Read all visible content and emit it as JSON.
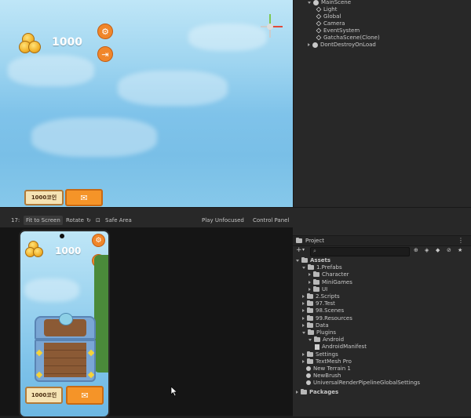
{
  "scene": {
    "score": "1000",
    "coin_button_label": "1000코인",
    "settings_icon": "gear-icon",
    "exit_icon": "exit-icon",
    "shop_icon": "shop-icon"
  },
  "hierarchy": {
    "rows": [
      {
        "label": "MainScene",
        "indent": 0,
        "type": "scene",
        "expanded": true
      },
      {
        "label": "Light",
        "indent": 1,
        "type": "gameobject"
      },
      {
        "label": "Global",
        "indent": 1,
        "type": "gameobject"
      },
      {
        "label": "Camera",
        "indent": 1,
        "type": "gameobject"
      },
      {
        "label": "EventSystem",
        "indent": 1,
        "type": "gameobject"
      },
      {
        "label": "GatchaScene(Clone)",
        "indent": 1,
        "type": "gameobject"
      },
      {
        "label": "DontDestroyOnLoad",
        "indent": 0,
        "type": "scene",
        "expanded": false
      }
    ]
  },
  "game_toolbar": {
    "display": "17:",
    "fit_to_screen": "Fit to Screen",
    "rotate": "Rotate",
    "safe_area": "Safe Area",
    "play_unfocused": "Play Unfocused",
    "control_panel": "Control Panel"
  },
  "game_view": {
    "score": "1000",
    "coin_button_label": "1000코인"
  },
  "project": {
    "tab_label": "Project",
    "search_placeholder": "",
    "rows": [
      {
        "label": "Assets",
        "indent": 0,
        "icon": "folder",
        "expanded": true,
        "bold": true
      },
      {
        "label": "1.Prefabs",
        "indent": 1,
        "icon": "folder",
        "expanded": true
      },
      {
        "label": "Character",
        "indent": 2,
        "icon": "folder",
        "expanded": false
      },
      {
        "label": "MiniGames",
        "indent": 2,
        "icon": "folder",
        "expanded": false
      },
      {
        "label": "UI",
        "indent": 2,
        "icon": "folder",
        "expanded": false
      },
      {
        "label": "2.Scripts",
        "indent": 1,
        "icon": "folder",
        "expanded": false
      },
      {
        "label": "97.Test",
        "indent": 1,
        "icon": "folder",
        "expanded": false
      },
      {
        "label": "98.Scenes",
        "indent": 1,
        "icon": "folder",
        "expanded": false
      },
      {
        "label": "99.Resources",
        "indent": 1,
        "icon": "folder",
        "expanded": false
      },
      {
        "label": "Data",
        "indent": 1,
        "icon": "folder",
        "expanded": false
      },
      {
        "label": "Plugins",
        "indent": 1,
        "icon": "folder",
        "expanded": true
      },
      {
        "label": "Android",
        "indent": 2,
        "icon": "folder",
        "expanded": true
      },
      {
        "label": "AndroidManifest",
        "indent": 3,
        "icon": "file"
      },
      {
        "label": "Settings",
        "indent": 1,
        "icon": "folder",
        "expanded": false
      },
      {
        "label": "TextMesh Pro",
        "indent": 1,
        "icon": "folder",
        "expanded": false
      },
      {
        "label": "New Terrain 1",
        "indent": 1,
        "icon": "asset"
      },
      {
        "label": "NewBrush",
        "indent": 1,
        "icon": "asset"
      },
      {
        "label": "UniversalRenderPipelineGlobalSettings",
        "indent": 1,
        "icon": "asset"
      },
      {
        "label": "Packages",
        "indent": 0,
        "icon": "folder",
        "expanded": false,
        "bold": true
      }
    ]
  }
}
